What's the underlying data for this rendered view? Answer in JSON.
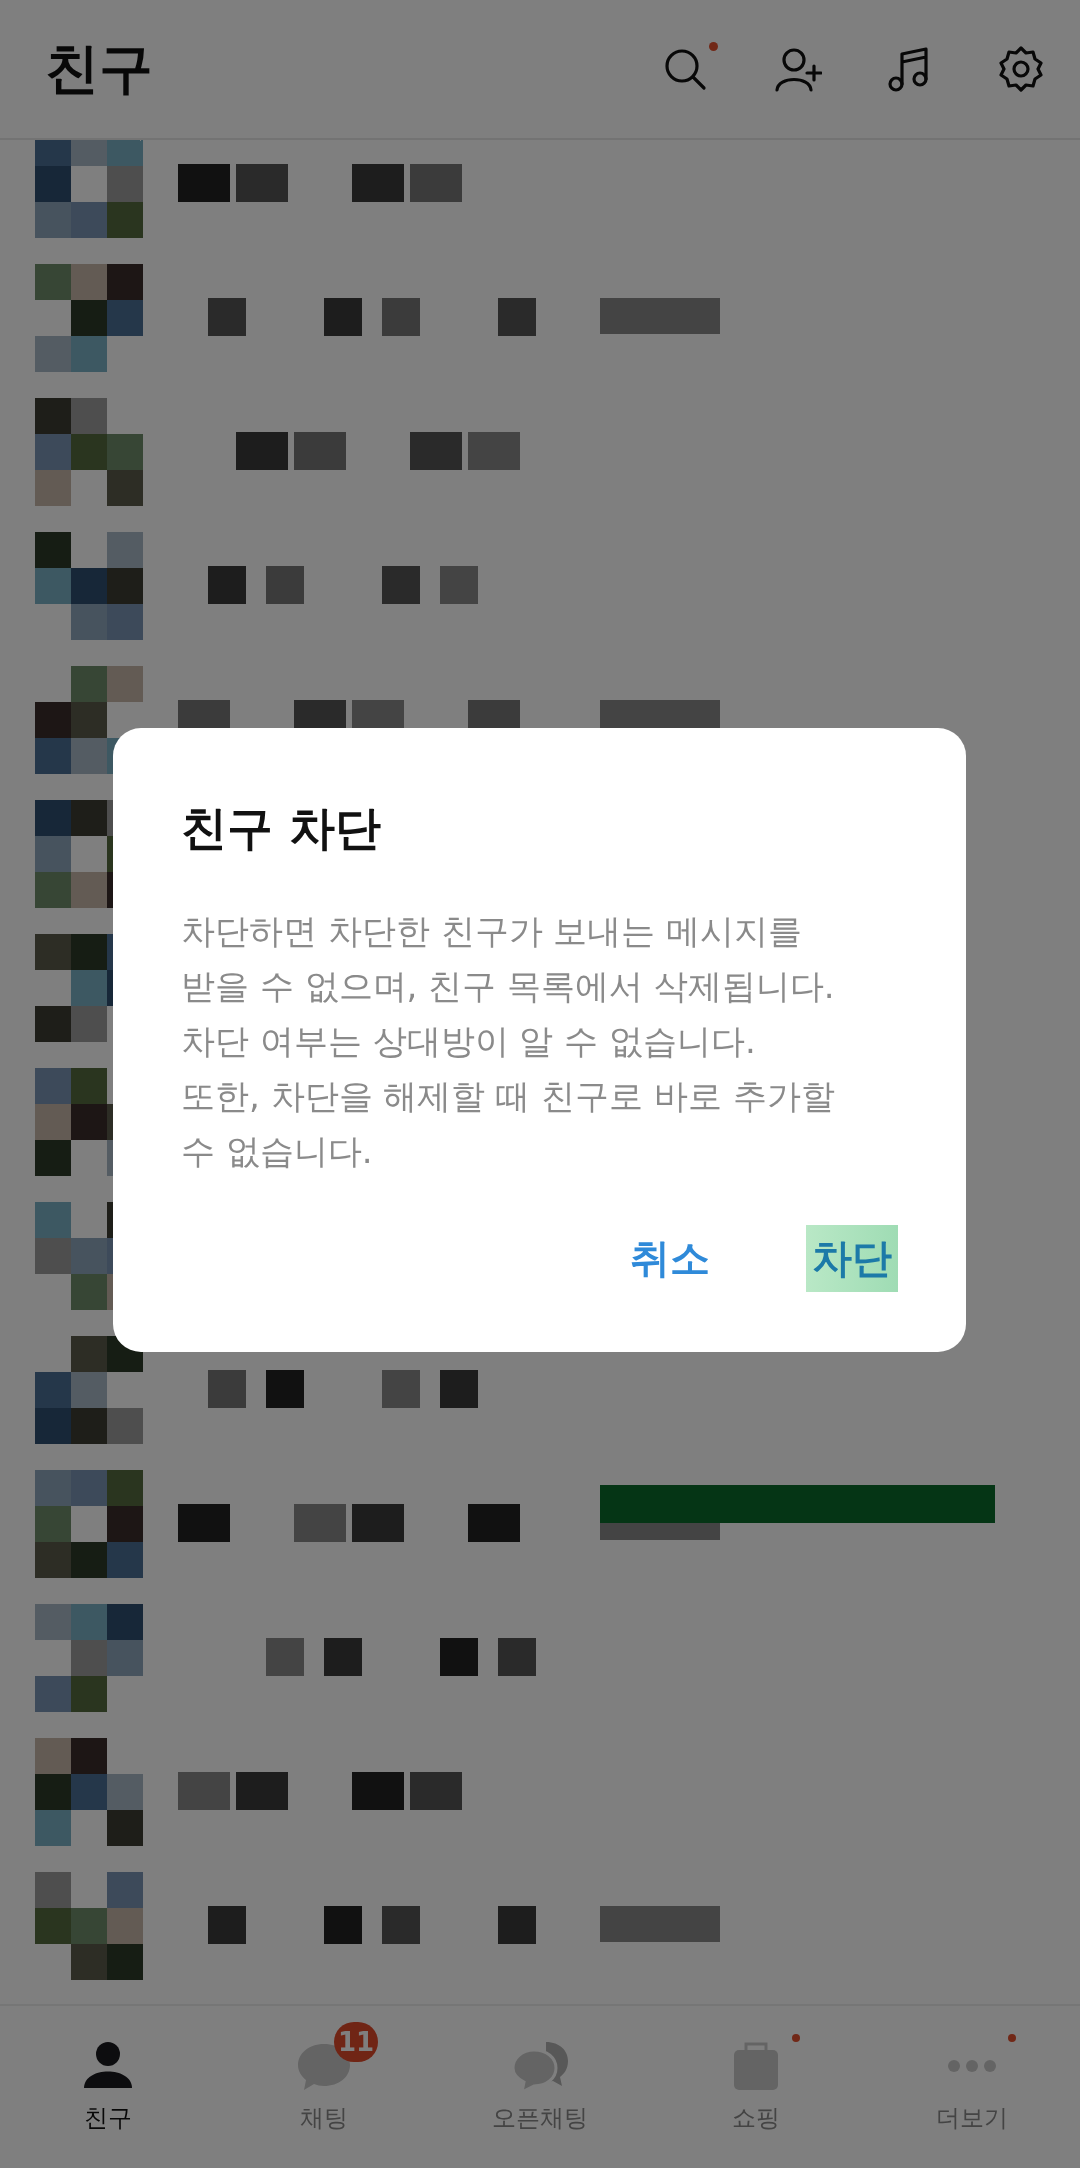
{
  "header": {
    "title": "친구",
    "actions": [
      {
        "kind": "search",
        "dot": true
      },
      {
        "kind": "add-friend",
        "dot": false
      },
      {
        "kind": "music",
        "dot": false
      },
      {
        "kind": "settings",
        "dot": false
      }
    ]
  },
  "dialog": {
    "title": "친구 차단",
    "message": "차단하면 차단한 친구가 보내는 메시지를\n받을 수 없으며, 친구 목록에서 삭제됩니다.\n차단 여부는 상대방이 알 수 없습니다.\n또한, 차단을 해제할 때 친구로 바로 추가할\n수 없습니다.",
    "buttons": [
      {
        "label": "취소",
        "highlighted": false
      },
      {
        "label": "차단",
        "highlighted": true
      }
    ]
  },
  "bottom_nav": [
    {
      "kind": "friends",
      "label": "친구",
      "selected": true,
      "dot": false
    },
    {
      "kind": "chats",
      "label": "채팅",
      "selected": false,
      "badge": "11",
      "dot": false
    },
    {
      "kind": "openchat",
      "label": "오픈채팅",
      "selected": false,
      "dot": false
    },
    {
      "kind": "shopping",
      "label": "쇼핑",
      "selected": false,
      "dot": true
    },
    {
      "kind": "more",
      "label": "더보기",
      "selected": false,
      "dot": true
    }
  ]
}
